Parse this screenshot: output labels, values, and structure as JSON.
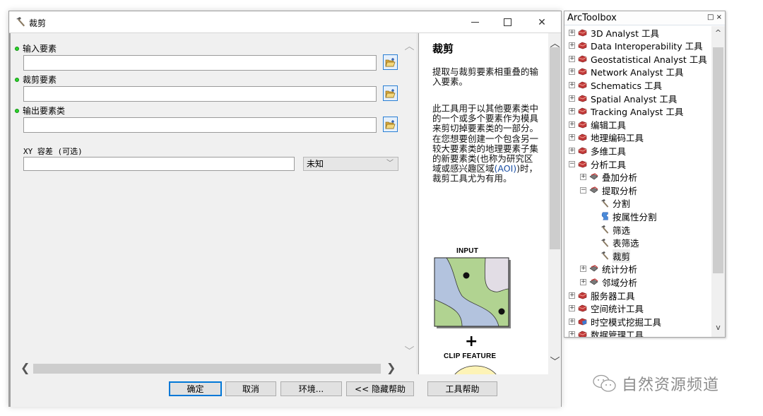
{
  "dialog": {
    "title": "裁剪",
    "icons": {
      "app": "hammer-icon",
      "minimize": "minimize-icon",
      "maximize": "maximize-icon",
      "close": "close-icon"
    },
    "close_glyph": "✕",
    "params": [
      {
        "label": "输入要素",
        "required": true,
        "value": "",
        "browse_icon": "open-folder-icon"
      },
      {
        "label": "裁剪要素",
        "required": true,
        "value": "",
        "browse_icon": "open-folder-icon"
      },
      {
        "label": "输出要素类",
        "required": true,
        "value": "",
        "browse_icon": "open-folder-icon"
      }
    ],
    "xy_tolerance": {
      "label": "XY 容差 (可选)",
      "value": "",
      "unit": "未知"
    },
    "buttons": {
      "ok": "确定",
      "cancel": "取消",
      "env": "环境...",
      "hide_help": "<< 隐藏帮助",
      "tool_help": "工具帮助"
    },
    "scroll_glyphs": {
      "up": "︿",
      "down": "﹀",
      "left": "❮",
      "right": "❯"
    }
  },
  "help": {
    "title": "裁剪",
    "para1": "提取与裁剪要素相重叠的输入要素。",
    "para2_pre": "此工具用于以其他要素类中的一个或多个要素作为模具来剪切掉要素类的一部分。在您想要创建一个包含另一较大要素类的地理要素子集的新要素类(也称为研究区域或感兴趣区域",
    "para2_aoi": "(AOI)",
    "para2_post": ")时，裁剪工具尤为有用。",
    "figure": {
      "input_label": "INPUT",
      "plus": "+",
      "clip_label": "CLIP FEATURE"
    },
    "colors": {
      "blue_region": "#b3c3de",
      "green_region": "#b1d391",
      "gray_region": "#e2dde5",
      "clip_circle": "#fdf3b6"
    }
  },
  "toolbox": {
    "title": "ArcToolbox",
    "controls": "□ ×",
    "items": [
      {
        "label": "3D Analyst 工具",
        "level": 0,
        "expander": "+",
        "icon": "toolbox-icon"
      },
      {
        "label": "Data Interoperability 工具",
        "level": 0,
        "expander": "+",
        "icon": "toolbox-icon"
      },
      {
        "label": "Geostatistical Analyst 工具",
        "level": 0,
        "expander": "+",
        "icon": "toolbox-icon"
      },
      {
        "label": "Network Analyst 工具",
        "level": 0,
        "expander": "+",
        "icon": "toolbox-icon"
      },
      {
        "label": "Schematics 工具",
        "level": 0,
        "expander": "+",
        "icon": "toolbox-icon"
      },
      {
        "label": "Spatial Analyst 工具",
        "level": 0,
        "expander": "+",
        "icon": "toolbox-icon"
      },
      {
        "label": "Tracking Analyst 工具",
        "level": 0,
        "expander": "+",
        "icon": "toolbox-icon"
      },
      {
        "label": "编辑工具",
        "level": 0,
        "expander": "+",
        "icon": "toolbox-icon"
      },
      {
        "label": "地理编码工具",
        "level": 0,
        "expander": "+",
        "icon": "toolbox-icon"
      },
      {
        "label": "多维工具",
        "level": 0,
        "expander": "+",
        "icon": "toolbox-icon"
      },
      {
        "label": "分析工具",
        "level": 0,
        "expander": "−",
        "icon": "toolbox-icon"
      },
      {
        "label": "叠加分析",
        "level": 1,
        "expander": "+",
        "icon": "toolset-icon"
      },
      {
        "label": "提取分析",
        "level": 1,
        "expander": "−",
        "icon": "toolset-icon"
      },
      {
        "label": "分割",
        "level": 2,
        "expander": "",
        "icon": "hammer-icon"
      },
      {
        "label": "按属性分割",
        "level": 2,
        "expander": "",
        "icon": "script-icon"
      },
      {
        "label": "筛选",
        "level": 2,
        "expander": "",
        "icon": "hammer-icon"
      },
      {
        "label": "表筛选",
        "level": 2,
        "expander": "",
        "icon": "hammer-icon"
      },
      {
        "label": "裁剪",
        "level": 2,
        "expander": "",
        "icon": "hammer-icon",
        "selected": true
      },
      {
        "label": "统计分析",
        "level": 1,
        "expander": "+",
        "icon": "toolset-icon"
      },
      {
        "label": "邻域分析",
        "level": 1,
        "expander": "+",
        "icon": "toolset-icon"
      },
      {
        "label": "服务器工具",
        "level": 0,
        "expander": "+",
        "icon": "toolbox-icon"
      },
      {
        "label": "空间统计工具",
        "level": 0,
        "expander": "+",
        "icon": "toolbox-icon"
      },
      {
        "label": "时空模式挖掘工具",
        "level": 0,
        "expander": "+",
        "icon": "toolbox-blue-icon"
      },
      {
        "label": "数据管理工具",
        "level": 0,
        "expander": "+",
        "icon": "toolbox-icon"
      }
    ],
    "scroll_glyphs": {
      "up": "^",
      "down": "v"
    }
  },
  "watermark": {
    "text": "自然资源频道",
    "icon": "wechat-icon"
  }
}
